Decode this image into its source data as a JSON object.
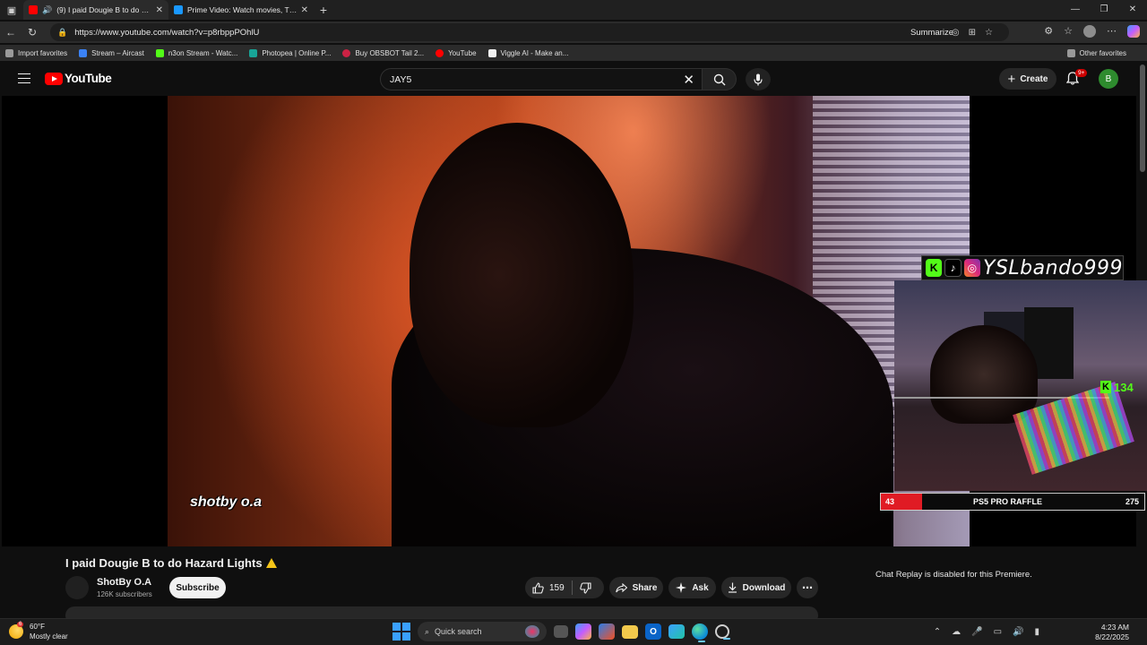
{
  "browser": {
    "tabs": [
      {
        "title": "(9) I paid Dougie B to do Hazard Lights",
        "favicon_color": "#ff0000",
        "active": true
      },
      {
        "title": "Prime Video: Watch movies, TV shows",
        "favicon_color": "#1a98ff",
        "active": false
      }
    ],
    "url": "https://www.youtube.com/watch?v=p8rbppPOhlU",
    "summarize_label": "Summarize",
    "bookmarks": [
      {
        "label": "Import favorites",
        "color": "#9a9a9a"
      },
      {
        "label": "Stream – Aircast",
        "color": "#3b82f6"
      },
      {
        "label": "n3on Stream - Watc...",
        "color": "#53fc18"
      },
      {
        "label": "Photopea | Online P...",
        "color": "#18a497"
      },
      {
        "label": "Buy OBSBOT Tail 2...",
        "color": "#cc2244"
      },
      {
        "label": "YouTube",
        "color": "#ff0000"
      },
      {
        "label": "Viggle AI - Make an...",
        "color": "#f1f1f1"
      }
    ],
    "other_favorites": "Other favorites"
  },
  "youtube": {
    "logo_text": "YouTube",
    "search_value": "JAY5",
    "create_label": "Create",
    "notification_badge": "9+",
    "account_initial": "B",
    "video": {
      "watermark": "shotby o.a",
      "overlay": {
        "streamer_name": "YSLbando999",
        "kick_count": "134",
        "raffle_left": "43",
        "raffle_label": "PS5 PRO RAFFLE",
        "raffle_right": "275",
        "raffle_progress": 0.156
      }
    },
    "title": "I paid Dougie B to do Hazard Lights",
    "channel": {
      "name": "ShotBy O.A",
      "subscribers": "126K subscribers"
    },
    "subscribe_label": "Subscribe",
    "like_count": "159",
    "share_label": "Share",
    "ask_label": "Ask",
    "download_label": "Download",
    "chat_replay_text": "Chat Replay is disabled for this Premiere."
  },
  "taskbar": {
    "weather_temp": "60°F",
    "weather_desc": "Mostly clear",
    "weather_badge": "6",
    "search_placeholder": "Quick search",
    "time": "4:23 AM",
    "date": "8/22/2025"
  }
}
